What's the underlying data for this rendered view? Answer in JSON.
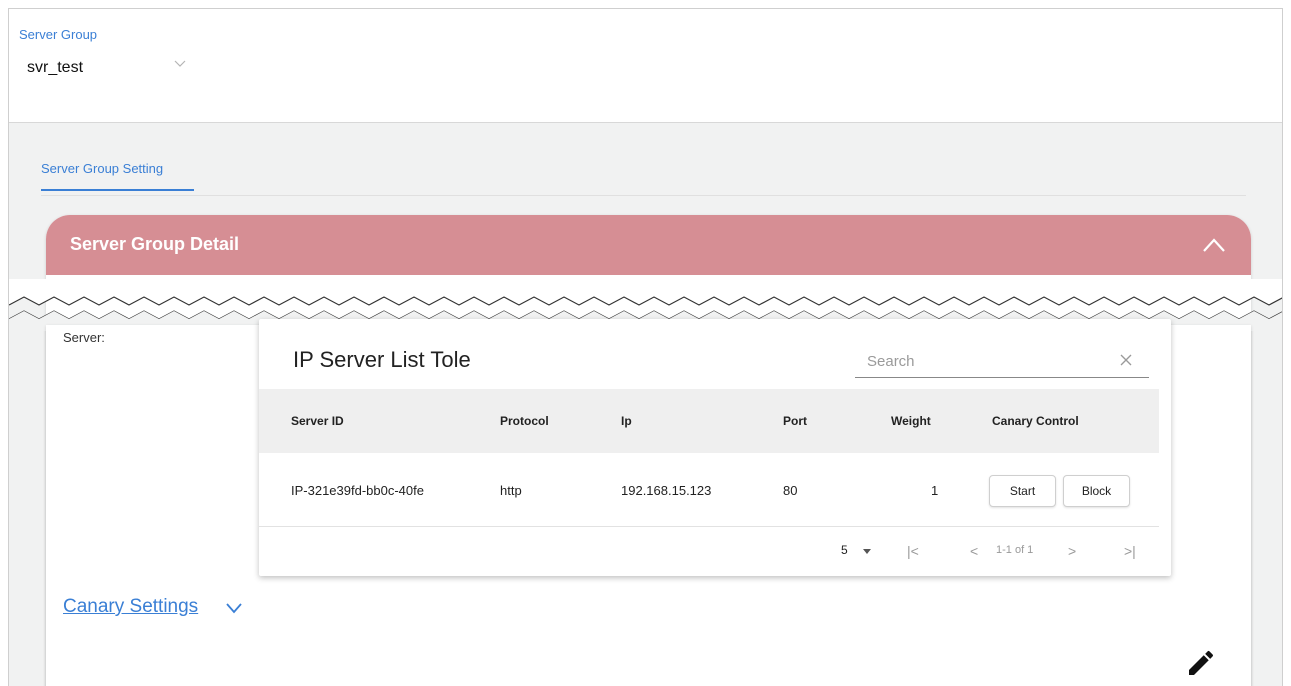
{
  "server_group": {
    "label": "Server Group",
    "value": "svr_test"
  },
  "tabs": [
    {
      "label": "Server Group Setting",
      "active": true
    }
  ],
  "detail": {
    "title": "Server Group Detail",
    "server_label": "Server:"
  },
  "table": {
    "title": "IP Server List Tole",
    "search_placeholder": "Search",
    "columns": [
      "Server ID",
      "Protocol",
      "Ip",
      "Port",
      "Weight",
      "Canary Control"
    ],
    "rows": [
      {
        "server_id": "IP-321e39fd-bb0c-40fe",
        "protocol": "http",
        "ip": "192.168.15.123",
        "port": "80",
        "weight": "1",
        "start_label": "Start",
        "block_label": "Block"
      }
    ],
    "pagination": {
      "page_size": "5",
      "range": "1-1 of 1"
    }
  },
  "canary": {
    "label": "Canary Settings"
  },
  "colors": {
    "accent": "#3a7fd5",
    "header": "#d68e94"
  }
}
